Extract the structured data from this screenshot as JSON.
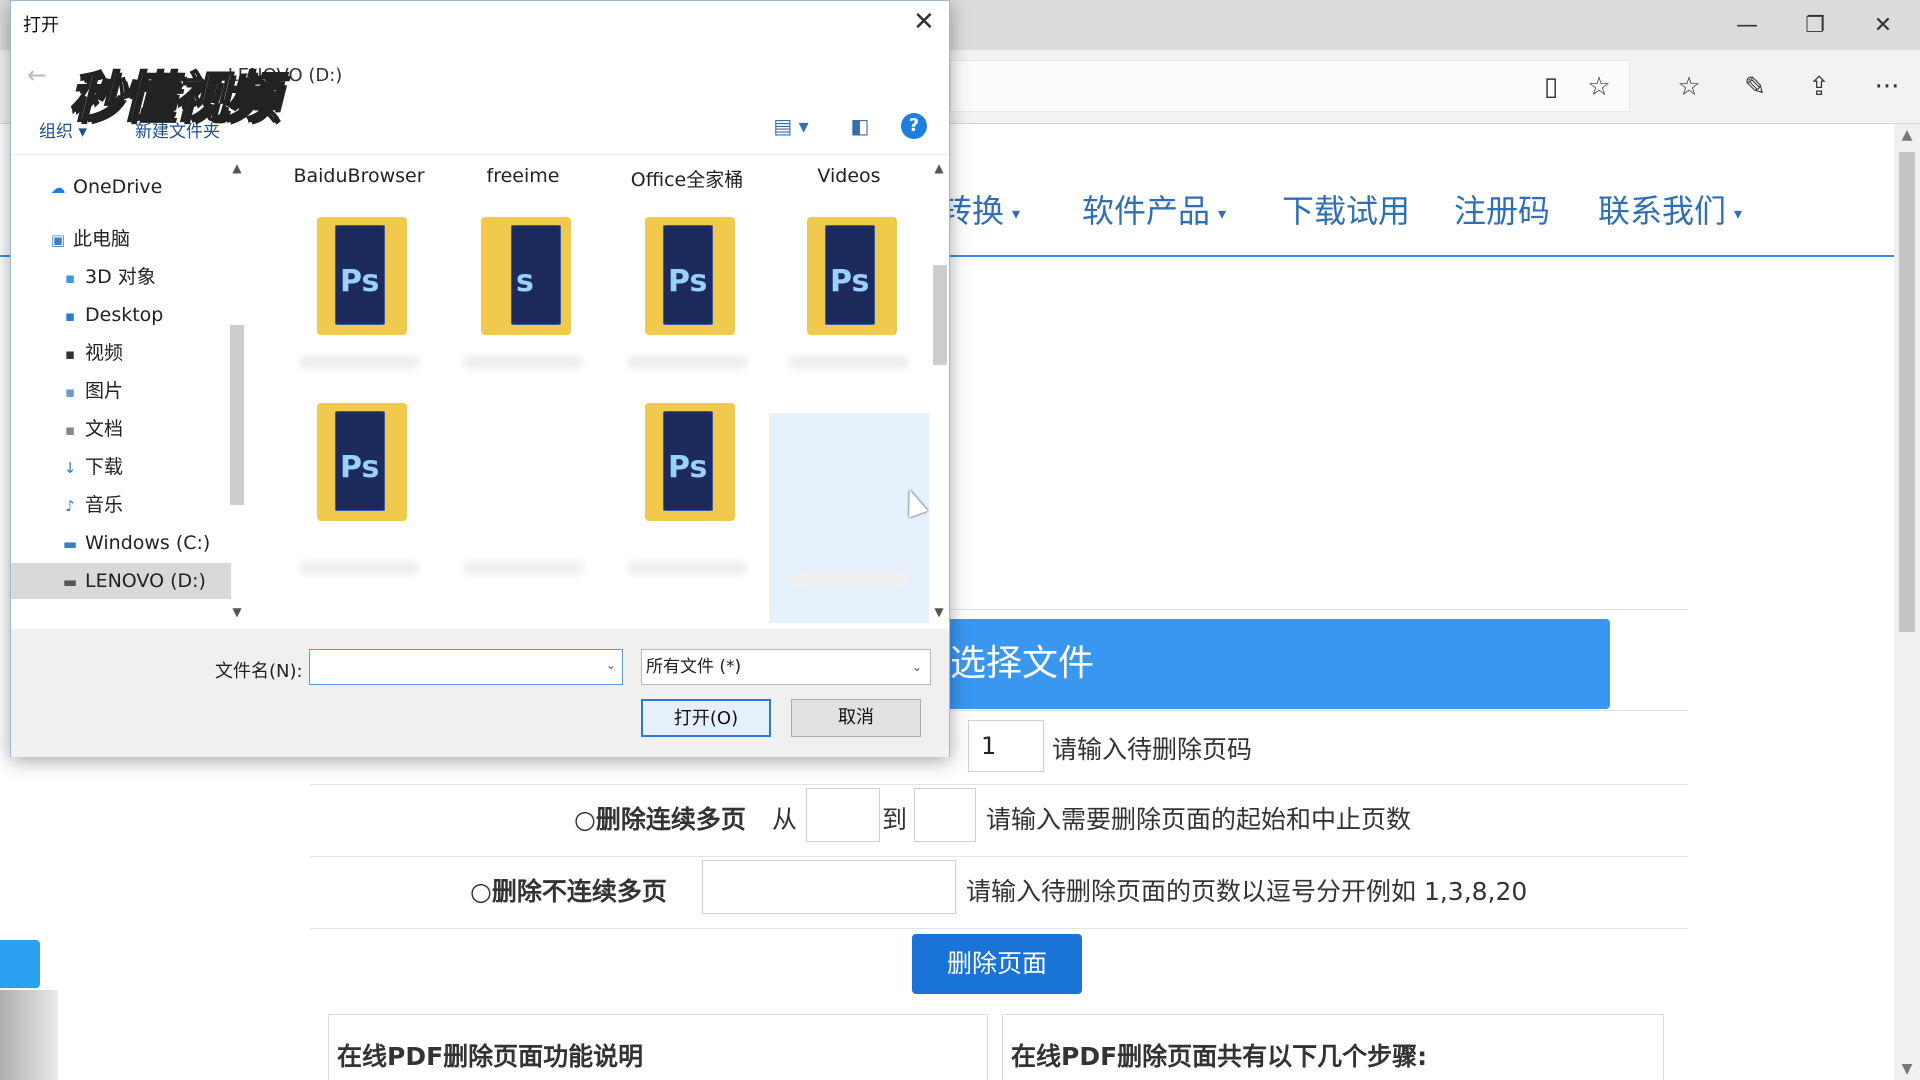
{
  "browser": {
    "window_controls": {
      "minimize": "—",
      "restore": "❐",
      "close": "✕"
    },
    "toolbar_icons": [
      "reading-view-icon",
      "favorite-star-icon",
      "favorites-list-icon",
      "notes-pen-icon",
      "share-icon",
      "more-icon"
    ],
    "toolbar_glyphs": {
      "reading": "▯",
      "star": "☆",
      "favorites": "☆",
      "pen": "✎",
      "share": "⇪",
      "more": "···"
    }
  },
  "site": {
    "nav": [
      {
        "label": "转换",
        "caret": "▾"
      },
      {
        "label": "软件产品",
        "caret": "▾"
      },
      {
        "label": "下载试用",
        "caret": ""
      },
      {
        "label": "注册码",
        "caret": ""
      },
      {
        "label": "联系我们",
        "caret": "▾"
      }
    ],
    "select_file_label": "选择文件",
    "single_page": {
      "value": "1",
      "hint": "请输入待删除页码"
    },
    "range": {
      "radio": "○",
      "label": "删除连续多页",
      "from": "从",
      "to": "到",
      "hint": "请输入需要删除页面的起始和中止页数"
    },
    "multi": {
      "radio": "○",
      "label": "删除不连续多页",
      "hint": "请输入待删除页面的页数以逗号分开例如 1,3,8,20"
    },
    "delete_button": "删除页面",
    "box_left_title": "在线PDF删除页面功能说明",
    "box_right_title": "在线PDF删除页面共有以下几个步骤:",
    "scroll_up": "▲",
    "scroll_down": "▼"
  },
  "dialog": {
    "title": "打开",
    "close": "✕",
    "back": "←",
    "breadcrumb": "« LENOVO (D:)",
    "organize": "组织 ▾",
    "new_folder": "新建文件夹",
    "view_icon": "▤ ▾",
    "pane_icon": "◧",
    "help": "?",
    "logo_text": "秒懂视频",
    "tree": [
      {
        "label": "OneDrive",
        "icon": "☁"
      },
      {
        "label": "此电脑",
        "icon": "▣"
      },
      {
        "label": "3D 对象",
        "icon": "▪"
      },
      {
        "label": "Desktop",
        "icon": "▪"
      },
      {
        "label": "视频",
        "icon": "▪"
      },
      {
        "label": "图片",
        "icon": "▪"
      },
      {
        "label": "文档",
        "icon": "▪"
      },
      {
        "label": "下载",
        "icon": "↓"
      },
      {
        "label": "音乐",
        "icon": "♪"
      },
      {
        "label": "Windows (C:)",
        "icon": "▬"
      },
      {
        "label": "LENOVO (D:)",
        "icon": "▬"
      }
    ],
    "files": [
      {
        "name": "BaiduBrowser",
        "ps": "Ps"
      },
      {
        "name": "freeime",
        "ps": "s"
      },
      {
        "name": "Office全家桶",
        "ps": "Ps"
      },
      {
        "name": "Videos",
        "ps": "Ps"
      },
      {
        "name": "",
        "ps": "Ps"
      },
      {
        "name": "",
        "ps": ""
      },
      {
        "name": "",
        "ps": "Ps"
      },
      {
        "name": "",
        "ps": ""
      }
    ],
    "filename_label": "文件名(N):",
    "filename_value": "",
    "filetype": "所有文件 (*)",
    "open_button": "打开(O)",
    "cancel_button": "取消",
    "arrows": {
      "up": "▲",
      "down": "▼",
      "dd": "⌄"
    }
  },
  "colors": {
    "accent": "#3a97f0",
    "nav_text": "#2f6fb5",
    "button": "#1a73d6",
    "folder": "#f0c94d"
  }
}
